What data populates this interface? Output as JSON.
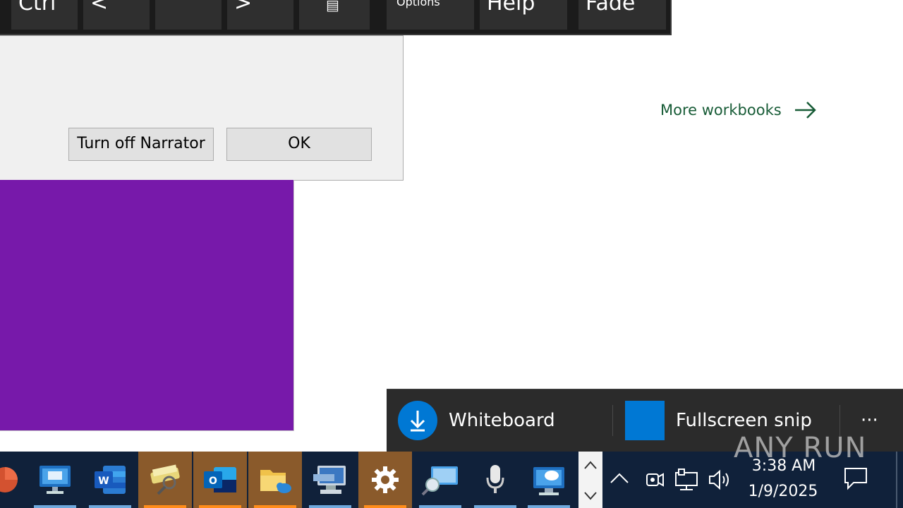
{
  "keyboard": {
    "keys": [
      {
        "label": "Ctrl"
      },
      {
        "label": "<"
      },
      {
        "label": ""
      },
      {
        "label": ">"
      },
      {
        "label": "▤"
      },
      {
        "label": "Options"
      },
      {
        "label": "Help"
      },
      {
        "label": "Fade"
      }
    ]
  },
  "dialog": {
    "turn_off_label": "Turn off Narrator",
    "ok_label": "OK"
  },
  "main": {
    "more_workbooks": "More workbooks"
  },
  "toast": {
    "whiteboard_label": "Whiteboard",
    "fullscreen_label": "Fullscreen snip",
    "more_label": "···"
  },
  "taskbar": {
    "apps": [
      "PowerPoint",
      "Remote Desktop",
      "Word",
      "Search Tool",
      "Outlook",
      "File Explorer",
      "Network Config",
      "Settings",
      "Magnifier",
      "Microphone",
      "Chat"
    ],
    "clock_time": "3:38 AM",
    "clock_date": "1/9/2025"
  },
  "watermark": "ANY RUN",
  "colors": {
    "purple_tile": "#7719aa",
    "link_green": "#185c37",
    "accent_blue": "#0078d4",
    "taskbar": "#10213a"
  }
}
